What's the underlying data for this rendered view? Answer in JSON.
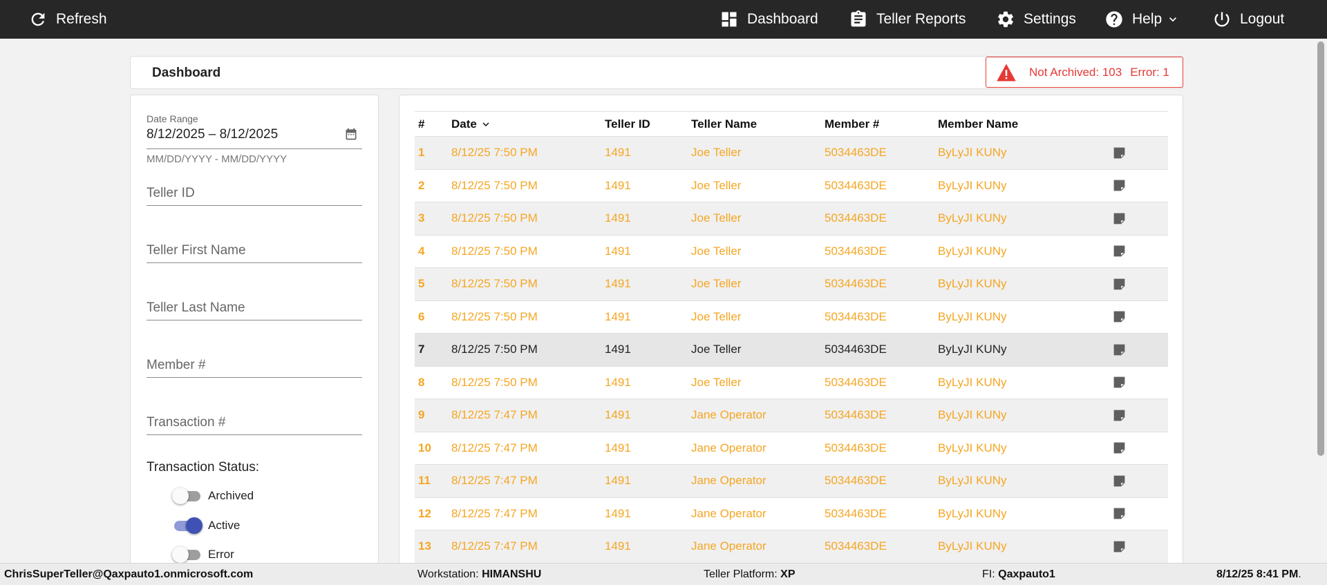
{
  "topbar": {
    "refresh": "Refresh",
    "dashboard": "Dashboard",
    "teller_reports": "Teller Reports",
    "settings": "Settings",
    "help": "Help",
    "logout": "Logout"
  },
  "header": {
    "title": "Dashboard",
    "alert_not_archived": "Not Archived: 103",
    "alert_error": "Error: 1"
  },
  "filters": {
    "date_range_label": "Date Range",
    "date_range_value": "8/12/2025 – 8/12/2025",
    "date_hint": "MM/DD/YYYY - MM/DD/YYYY",
    "teller_id": "Teller ID",
    "teller_first_name": "Teller First Name",
    "teller_last_name": "Teller Last Name",
    "member_num": "Member #",
    "transaction_num": "Transaction #",
    "status_title": "Transaction Status:",
    "toggles": [
      {
        "label": "Archived",
        "on": false
      },
      {
        "label": "Active",
        "on": true
      },
      {
        "label": "Error",
        "on": false
      }
    ]
  },
  "table": {
    "headers": [
      "#",
      "Date",
      "Teller ID",
      "Teller Name",
      "Member #",
      "Member Name"
    ],
    "rows": [
      {
        "n": "1",
        "date": "8/12/25 7:50 PM",
        "teller_id": "1491",
        "teller_name": "Joe Teller",
        "member_num": "5034463DE",
        "member_name": "ByLyJI KUNy",
        "color": "orange"
      },
      {
        "n": "2",
        "date": "8/12/25 7:50 PM",
        "teller_id": "1491",
        "teller_name": "Joe Teller",
        "member_num": "5034463DE",
        "member_name": "ByLyJI KUNy",
        "color": "orange"
      },
      {
        "n": "3",
        "date": "8/12/25 7:50 PM",
        "teller_id": "1491",
        "teller_name": "Joe Teller",
        "member_num": "5034463DE",
        "member_name": "ByLyJI KUNy",
        "color": "orange"
      },
      {
        "n": "4",
        "date": "8/12/25 7:50 PM",
        "teller_id": "1491",
        "teller_name": "Joe Teller",
        "member_num": "5034463DE",
        "member_name": "ByLyJI KUNy",
        "color": "orange"
      },
      {
        "n": "5",
        "date": "8/12/25 7:50 PM",
        "teller_id": "1491",
        "teller_name": "Joe Teller",
        "member_num": "5034463DE",
        "member_name": "ByLyJI KUNy",
        "color": "orange"
      },
      {
        "n": "6",
        "date": "8/12/25 7:50 PM",
        "teller_id": "1491",
        "teller_name": "Joe Teller",
        "member_num": "5034463DE",
        "member_name": "ByLyJI KUNy",
        "color": "orange"
      },
      {
        "n": "7",
        "date": "8/12/25 7:50 PM",
        "teller_id": "1491",
        "teller_name": "Joe Teller",
        "member_num": "5034463DE",
        "member_name": "ByLyJI KUNy",
        "color": "dark"
      },
      {
        "n": "8",
        "date": "8/12/25 7:50 PM",
        "teller_id": "1491",
        "teller_name": "Joe Teller",
        "member_num": "5034463DE",
        "member_name": "ByLyJI KUNy",
        "color": "orange"
      },
      {
        "n": "9",
        "date": "8/12/25 7:47 PM",
        "teller_id": "1491",
        "teller_name": "Jane Operator",
        "member_num": "5034463DE",
        "member_name": "ByLyJI KUNy",
        "color": "orange"
      },
      {
        "n": "10",
        "date": "8/12/25 7:47 PM",
        "teller_id": "1491",
        "teller_name": "Jane Operator",
        "member_num": "5034463DE",
        "member_name": "ByLyJI KUNy",
        "color": "orange"
      },
      {
        "n": "11",
        "date": "8/12/25 7:47 PM",
        "teller_id": "1491",
        "teller_name": "Jane Operator",
        "member_num": "5034463DE",
        "member_name": "ByLyJI KUNy",
        "color": "orange"
      },
      {
        "n": "12",
        "date": "8/12/25 7:47 PM",
        "teller_id": "1491",
        "teller_name": "Jane Operator",
        "member_num": "5034463DE",
        "member_name": "ByLyJI KUNy",
        "color": "orange"
      },
      {
        "n": "13",
        "date": "8/12/25 7:47 PM",
        "teller_id": "1491",
        "teller_name": "Jane Operator",
        "member_num": "5034463DE",
        "member_name": "ByLyJI KUNy",
        "color": "orange"
      }
    ]
  },
  "statusbar": {
    "user": "ChrisSuperTeller@Qaxpauto1.onmicrosoft.com",
    "workstation_label": "Workstation: ",
    "workstation_value": "HIMANSHU",
    "platform_label": "Teller Platform: ",
    "platform_value": "XP",
    "fi_label": "FI: ",
    "fi_value": "Qaxpauto1",
    "datetime": "8/12/25 8:41 PM",
    "datetime_suffix": "."
  },
  "colors": {
    "topbar_bg": "#272727",
    "row_orange": "#f5a623",
    "alert_red": "#e53935",
    "toggle_active": "#3f51b5"
  },
  "icons": [
    "refresh-icon",
    "dashboard-icon",
    "clipboard-icon",
    "gear-icon",
    "help-icon",
    "chevron-down-icon",
    "power-icon",
    "warning-icon",
    "calendar-icon",
    "sort-down-icon",
    "note-icon"
  ]
}
